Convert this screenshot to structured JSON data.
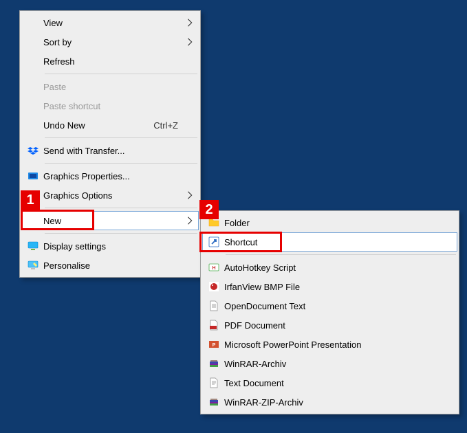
{
  "annotations": {
    "marker1": "1",
    "marker2": "2"
  },
  "menu1": {
    "view": "View",
    "sort_by": "Sort by",
    "refresh": "Refresh",
    "paste": "Paste",
    "paste_shortcut": "Paste shortcut",
    "undo_new": "Undo New",
    "undo_new_accel": "Ctrl+Z",
    "send_with_transfer": "Send with Transfer...",
    "graphics_properties": "Graphics Properties...",
    "graphics_options": "Graphics Options",
    "new": "New",
    "display_settings": "Display settings",
    "personalise": "Personalise"
  },
  "menu2": {
    "folder": "Folder",
    "shortcut": "Shortcut",
    "autohotkey_script": "AutoHotkey Script",
    "irfanview_bmp": "IrfanView BMP File",
    "opendocument_text": "OpenDocument Text",
    "pdf_document": "PDF Document",
    "powerpoint": "Microsoft PowerPoint Presentation",
    "winrar_archiv": "WinRAR-Archiv",
    "text_document": "Text Document",
    "winrar_zip": "WinRAR-ZIP-Archiv"
  }
}
